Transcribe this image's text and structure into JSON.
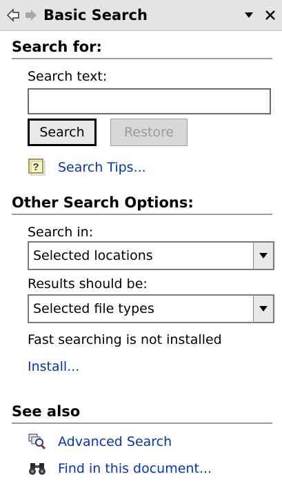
{
  "titlebar": {
    "title": "Basic Search",
    "back_icon": "back-arrow-icon",
    "forward_icon": "forward-arrow-icon",
    "menu_icon": "dropdown-triangle-icon",
    "close_icon": "close-icon"
  },
  "search_for": {
    "heading": "Search for:",
    "search_text_label": "Search text:",
    "search_text_value": "",
    "search_button": "Search",
    "restore_button": "Restore",
    "tips_link": "Search Tips...",
    "tips_icon": "help-question-icon"
  },
  "other_options": {
    "heading": "Other Search Options:",
    "search_in_label": "Search in:",
    "search_in_value": "Selected locations",
    "results_label": "Results should be:",
    "results_value": "Selected file types",
    "fast_search_status": "Fast searching is not installed",
    "install_link": "Install..."
  },
  "see_also": {
    "heading": "See also",
    "links": [
      {
        "label": "Advanced Search",
        "icon": "advanced-search-icon"
      },
      {
        "label": "Find in this document...",
        "icon": "binoculars-icon"
      }
    ]
  },
  "colors": {
    "link": "#0033cc",
    "titlebar_bg": "#e4e4e4",
    "rule": "#9a9a9a"
  }
}
